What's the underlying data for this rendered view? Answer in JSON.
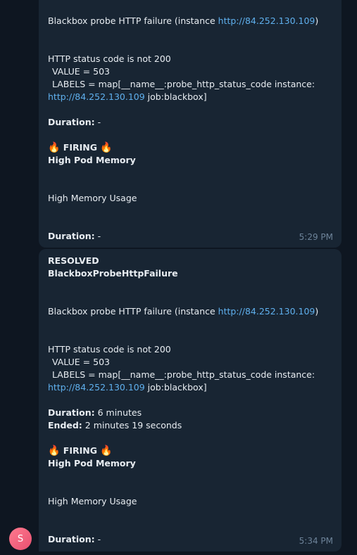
{
  "messages": [
    {
      "summary_text_prefix": "Blackbox probe HTTP failure (instance ",
      "summary_link": "http://84.252.130.109",
      "summary_text_suffix": ")",
      "status_line": "HTTP status code is not 200",
      "value_line": "VALUE = 503",
      "labels_line": "LABELS = map[__name__:probe_http_status_code instance:",
      "labels_link": "http://84.252.130.109",
      "labels_suffix": " job:blackbox]",
      "duration_label": "Duration:",
      "duration_value": " -",
      "firing_emoji": "🔥",
      "firing_label": "FIRING",
      "firing_title": "High Pod Memory",
      "firing_desc": "High Memory Usage",
      "firing_duration_label": "Duration:",
      "firing_duration_value": " -",
      "time": "5:29 PM"
    },
    {
      "resolved_label": "RESOLVED",
      "resolved_title": "BlackboxProbeHttpFailure",
      "summary_text_prefix": "Blackbox probe HTTP failure (instance ",
      "summary_link": "http://84.252.130.109",
      "summary_text_suffix": ")",
      "status_line": "HTTP status code is not 200",
      "value_line": "VALUE = 503",
      "labels_line": "LABELS = map[__name__:probe_http_status_code instance:",
      "labels_link": "http://84.252.130.109",
      "labels_suffix": " job:blackbox]",
      "duration_label": "Duration:",
      "duration_value": " 6 minutes",
      "ended_label": "Ended:",
      "ended_value": " 2 minutes 19 seconds",
      "firing_emoji": "🔥",
      "firing_label": "FIRING",
      "firing_title": "High Pod Memory",
      "firing_desc": "High Memory Usage",
      "firing_duration_label": "Duration:",
      "firing_duration_value": " -",
      "time": "5:34 PM"
    }
  ],
  "avatar": {
    "initial": "S",
    "colors": [
      "#ff7a8f",
      "#e85070"
    ]
  }
}
